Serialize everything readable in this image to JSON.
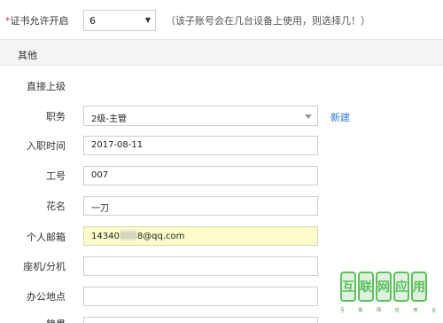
{
  "certificate": {
    "required_mark": "*",
    "label": "证书允许开启",
    "selected_value": "6",
    "dropdown_caret": "▼",
    "hint": "（该子账号会在几台设备上使用，则选择几！）"
  },
  "section": {
    "title": "其他"
  },
  "fields": {
    "supervisor": {
      "label": "直接上级"
    },
    "position": {
      "label": "职务",
      "value": "2级-主管",
      "new_link": "新建"
    },
    "hire_date": {
      "label": "入职时间",
      "value": "2017-08-11"
    },
    "employee_no": {
      "label": "工号",
      "value": "007"
    },
    "nickname": {
      "label": "花名",
      "value": "一刀"
    },
    "email": {
      "label": "个人邮箱",
      "value_prefix": "14340",
      "value_suffix": "8@qq.com"
    },
    "landline": {
      "label": "座机/分机",
      "value": ""
    },
    "office": {
      "label": "办公地点",
      "value": ""
    },
    "next": {
      "label": "籍贯"
    }
  },
  "watermark": {
    "chars": [
      "互",
      "联",
      "网",
      "应",
      "用"
    ],
    "subtitle": "互 联 网 应 用 合 集"
  },
  "colors": {
    "required": "#e4393c",
    "link": "#2b7bd3",
    "highlight": "#fcfccb",
    "watermark": "#5cc05c"
  }
}
